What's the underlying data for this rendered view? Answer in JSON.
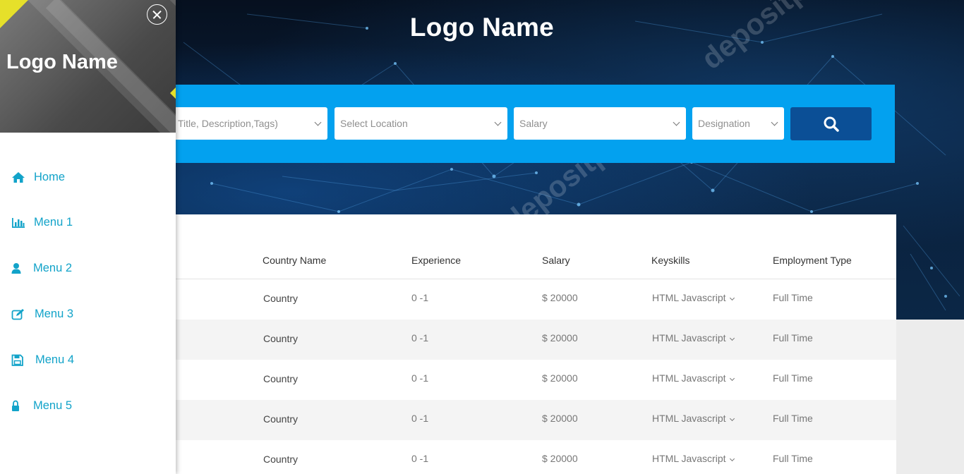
{
  "hero": {
    "title": "Logo Name",
    "watermark": "depositphotos"
  },
  "sidebar": {
    "logo": "Logo Name",
    "close_icon": "close-circle-icon",
    "items": [
      {
        "label": "Home",
        "icon": "home-icon"
      },
      {
        "label": "Menu 1",
        "icon": "bar-chart-icon"
      },
      {
        "label": "Menu 2",
        "icon": "user-icon"
      },
      {
        "label": "Menu 3",
        "icon": "edit-icon"
      },
      {
        "label": "Menu 4",
        "icon": "save-icon"
      },
      {
        "label": "Menu 5",
        "icon": "lock-icon"
      }
    ]
  },
  "search": {
    "keyword_placeholder": "Title, Description,Tags)",
    "location_placeholder": "Select Location",
    "salary_placeholder": "Salary",
    "designation_placeholder": "Designation",
    "button_icon": "search-icon",
    "button_color": "#0b4f96",
    "bar_color": "#03a1ef"
  },
  "table": {
    "headers": [
      "Country Name",
      "Experience",
      "Salary",
      "Keyskills",
      "Employment Type"
    ],
    "rows": [
      [
        "Country",
        "0 -1",
        "$ 20000",
        "HTML Javascript",
        "Full Time"
      ],
      [
        "Country",
        "0 -1",
        "$ 20000",
        "HTML Javascript",
        "Full Time"
      ],
      [
        "Country",
        "0 -1",
        "$ 20000",
        "HTML Javascript",
        "Full Time"
      ],
      [
        "Country",
        "0 -1",
        "$ 20000",
        "HTML Javascript",
        "Full Time"
      ],
      [
        "Country",
        "0 -1",
        "$ 20000",
        "HTML Javascript",
        "Full Time"
      ]
    ]
  },
  "colors": {
    "accent": "#12a3c9",
    "sidebar_yellow": "#e6e02a"
  }
}
